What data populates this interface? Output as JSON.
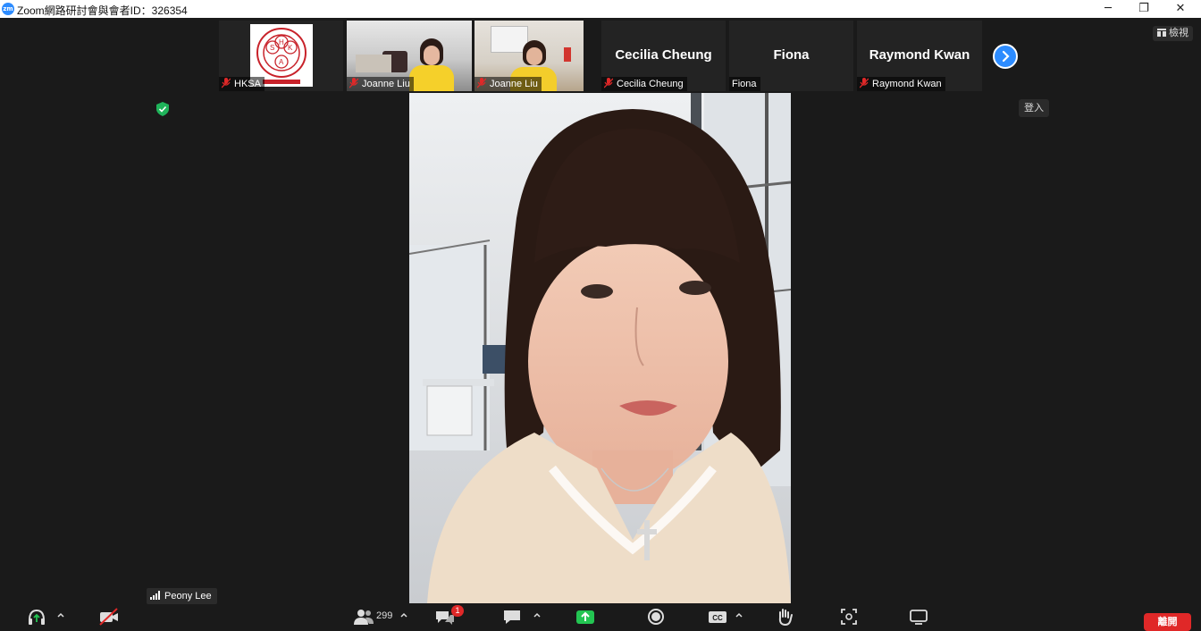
{
  "window": {
    "title": "Zoom網路研討會與會者ID：326354",
    "logo_text": "zm",
    "minimize": "─",
    "restore": "❐",
    "close": "✕"
  },
  "thumbnails": [
    {
      "name": "HKSA",
      "muted": true,
      "type": "logo"
    },
    {
      "name": "Joanne Liu",
      "muted": true,
      "type": "video"
    },
    {
      "name": "Joanne Liu",
      "muted": true,
      "type": "video"
    },
    {
      "name": "Cecilia Cheung",
      "muted": true,
      "type": "name",
      "display": "Cecilia Cheung"
    },
    {
      "name": "Fiona",
      "muted": false,
      "type": "name",
      "display": "Fiona"
    },
    {
      "name": "Raymond Kwan",
      "muted": true,
      "type": "name",
      "display": "Raymond Kwan"
    }
  ],
  "hksa_logo_letters": [
    "H",
    "S",
    "K",
    "A"
  ],
  "view_button": "檢視",
  "signin_button": "登入",
  "active_speaker": "Peony Lee",
  "toolbar": {
    "participants_count": "299",
    "chat_badge": "1",
    "leave_label": "離開"
  },
  "colors": {
    "accent_blue": "#2d8cff",
    "share_green": "#23c552",
    "leave_red": "#e02828",
    "mute_red": "#e02828"
  },
  "icons": {
    "audio": "headphones-icon",
    "video": "video-off-icon",
    "participants": "participants-icon",
    "qa": "qa-icon",
    "chat": "chat-icon",
    "share": "share-screen-icon",
    "record": "record-icon",
    "captions": "cc-icon",
    "reactions": "raise-hand-icon",
    "focus": "focus-icon",
    "view": "screen-icon"
  }
}
